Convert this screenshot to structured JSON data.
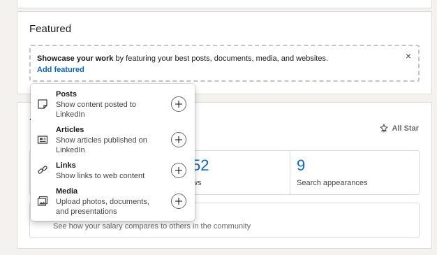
{
  "featured": {
    "title": "Featured",
    "showcase_bold": "Showcase your work",
    "showcase_rest": " by featuring your best posts, documents, media, and websites.",
    "add_link": "Add featured",
    "close_glyph": "×"
  },
  "dashboard": {
    "heading_partial": "Y",
    "all_star": "All Star",
    "stat_partial_value": "52",
    "stat_partial_label": "ws",
    "search_appearances_value": "9",
    "search_appearances_label": "Search appearances",
    "salary_text": "See how your salary compares to others in the community"
  },
  "add_featured_menu": {
    "items": [
      {
        "title": "Posts",
        "description": "Show content posted to LinkedIn",
        "icon": "post-icon"
      },
      {
        "title": "Articles",
        "description": "Show articles published on LinkedIn",
        "icon": "article-icon"
      },
      {
        "title": "Links",
        "description": "Show links to web content",
        "icon": "link-icon"
      },
      {
        "title": "Media",
        "description": "Upload photos, documents, and presentations",
        "icon": "media-icon"
      }
    ]
  },
  "colors": {
    "link": "#0a66c2",
    "page_bg": "#f3f2ef",
    "card_border": "#dcdad6"
  }
}
